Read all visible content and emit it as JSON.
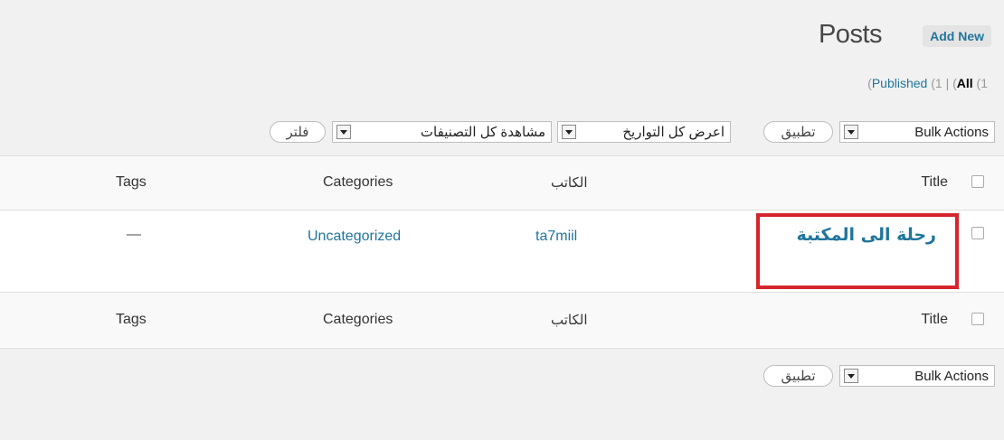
{
  "header": {
    "title": "Posts",
    "add_new_label": "Add New"
  },
  "status_filter": {
    "all_label": "All",
    "all_count_open": "(1",
    "published_label": "Published",
    "published_count_open": "(1",
    "separator": "|",
    "paren_open": "("
  },
  "tablenav_top": {
    "bulk_actions": "Bulk Actions",
    "apply_label": "تطبيق",
    "dates_filter": "اعرض كل التواريخ",
    "categories_filter": "مشاهدة كل التصنيفات",
    "filter_button": "فلتر"
  },
  "table": {
    "columns": {
      "title": "Title",
      "author": "الكاتب",
      "categories": "Categories",
      "tags": "Tags"
    },
    "rows": [
      {
        "title": "رحلة الى المكتبة",
        "author": "ta7miil",
        "categories": "Uncategorized",
        "tags": "—"
      }
    ]
  },
  "tablenav_bottom": {
    "bulk_actions": "Bulk Actions",
    "apply_label": "تطبيق"
  },
  "colors": {
    "link": "#21759b",
    "highlight": "#d6252c",
    "background": "#f1f1f1"
  }
}
